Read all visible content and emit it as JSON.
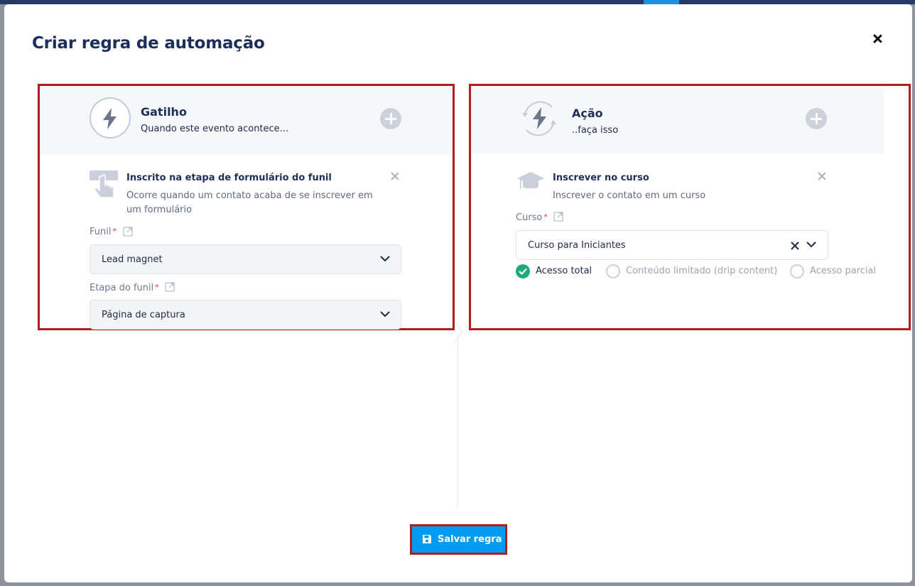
{
  "modal": {
    "title": "Criar regra de automação"
  },
  "trigger": {
    "header_title": "Gatilho",
    "header_subtitle": "Quando este evento acontece...",
    "item_title": "Inscrito na etapa de formulário do funil",
    "item_description": "Ocorre quando um contato acaba de se inscrever em um formulário",
    "funnel_label": "Funil",
    "funnel_value": "Lead magnet",
    "stage_label": "Etapa do funil",
    "stage_value": "Página de captura",
    "required_mark": "*"
  },
  "action": {
    "header_title": "Ação",
    "header_subtitle": "..faça isso",
    "item_title": "Inscrever no curso",
    "item_description": "Inscrever o contato em um curso",
    "course_label": "Curso",
    "course_value": "Curso para Iniciantes",
    "required_mark": "*",
    "access_options": [
      {
        "label": "Acesso total",
        "selected": true
      },
      {
        "label": "Conteúdo limitado (drip content)",
        "selected": false
      },
      {
        "label": "Acesso parcial",
        "selected": false
      }
    ]
  },
  "footer": {
    "save_label": "Salvar regra"
  },
  "colors": {
    "primary": "#009cf4",
    "title": "#1c2f5a",
    "success": "#1ea97c",
    "required": "#e2364a",
    "highlight_border": "#b11e1e"
  },
  "icons": {
    "close": "close-icon",
    "bolt": "lightning-bolt-icon",
    "add": "plus-circle-icon",
    "hand": "hand-pointer-icon",
    "course": "graduation-cap-icon",
    "external": "external-link-icon",
    "chevron": "chevron-down-icon",
    "clear": "clear-x-icon",
    "save": "floppy-disk-icon"
  }
}
